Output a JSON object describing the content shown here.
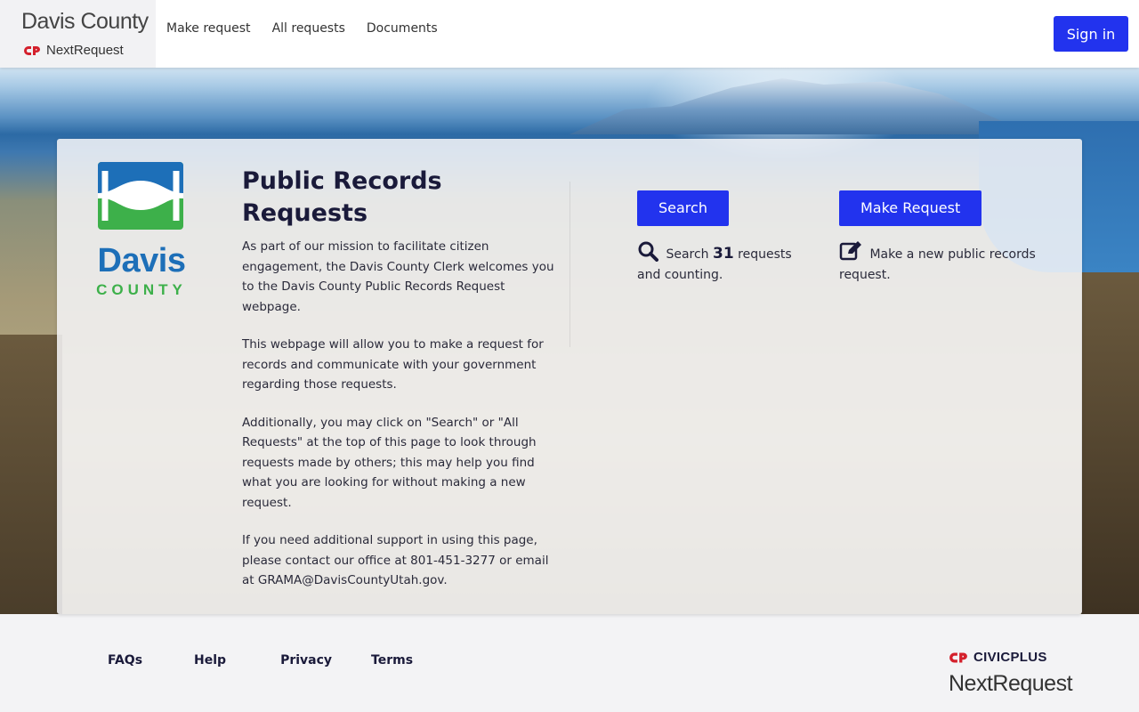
{
  "header": {
    "brand_name": "Davis County",
    "brand_sub": "NextRequest",
    "nav": [
      "Make request",
      "All requests",
      "Documents"
    ],
    "signin_label": "Sign in",
    "accent": "#2233ee"
  },
  "logo": {
    "top": "Davis",
    "bottom": "COUNTY"
  },
  "intro": {
    "title": "Public Records Requests",
    "paragraphs": [
      "As part of our mission to facilitate citizen engagement, the Davis County Clerk welcomes you to the Davis County Public Records Request webpage.",
      "This webpage will allow you to make a request for records and communicate with your government regarding those requests.",
      "Additionally, you may click on \"Search\" or \"All Requests\" at the top of this page to look through requests made by others; this may help you find what you are looking for without making a new request.",
      "If you need additional support in using this page, please contact our office at 801-451-3277 or email at GRAMA@DavisCountyUtah.gov."
    ]
  },
  "search": {
    "button_label": "Search",
    "desc_prefix": "Search",
    "count": "31",
    "desc_suffix": "requests and counting.",
    "icon": "search-icon"
  },
  "make_request": {
    "button_label": "Make Request",
    "desc": "Make a new public records request.",
    "icon": "edit-icon"
  },
  "footer": {
    "links": [
      "FAQs",
      "Help",
      "Privacy",
      "Terms"
    ],
    "civic_brand": "CIVICPLUS",
    "civic_product": "NextRequest",
    "brand_red": "#d4202c"
  }
}
